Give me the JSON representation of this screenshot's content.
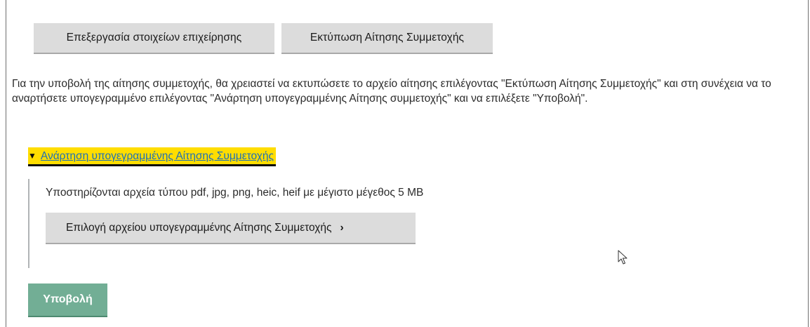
{
  "actions": {
    "edit_business_label": "Επεξεργασία στοιχείων επιχείρησης",
    "print_application_label": "Εκτύπωση Αίτησης Συμμετοχής"
  },
  "instructions": "Για την υποβολή της αίτησης συμμετοχής, θα χρειαστεί να εκτυπώσετε το αρχείο αίτησης επιλέγοντας \"Εκτύπωση Αίτησης Συμμετοχής\" και στη συνέχεια να το αναρτήσετε υπογεγραμμένο επιλέγοντας \"Ανάρτηση υπογεγραμμένης Αίτησης συμμετοχής\" και να επιλέξετε \"Υποβολή\".",
  "upload_section": {
    "summary_label": "Ανάρτηση υπογεγραμμένης Αίτησης Συμμετοχής",
    "expanded": true,
    "supported_files_text": "Υποστηρίζονται αρχεία τύπου pdf, jpg, png, heic, heif με μέγιστο μέγεθος 5 MB",
    "choose_file_label": "Επιλογή αρχείου υπογεγραμμένης Αίτησης Συμμετοχής",
    "choose_file_chevron": "›"
  },
  "submit_label": "Υποβολή",
  "colors": {
    "grey_button_bg": "#dcdcdc",
    "submit_bg": "#72ae95",
    "focus_highlight": "#ffdd00",
    "link": "#1d70b8"
  },
  "icons": {
    "summary_toggle": "triangle-down-icon",
    "pointer": "mouse-pointer-icon"
  }
}
